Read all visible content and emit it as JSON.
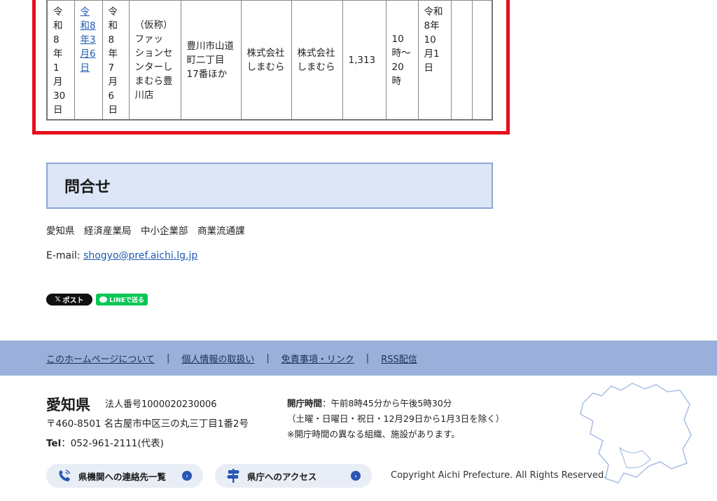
{
  "table": {
    "cells": [
      "令\n和\n8\n年1\n月\n30\n日",
      "令\n和8\n年3\n月6\n日",
      "令\n和8\n年7\n月6\n日",
      "（仮称）\nファッ\nションセ\nンターし\nまむら豊\n川店",
      "豊川市山道\n町二丁目\n17番ほか",
      "株式会社\nしまむら",
      "株式会社\nしまむら",
      "1,313",
      "10\n時～\n20\n時",
      "令和\n8年\n10\n月1\n日",
      "",
      ""
    ]
  },
  "contact": {
    "heading": "問合せ",
    "department": "愛知県　経済産業局　中小企業部　商業流通課",
    "email_label": "E-mail: ",
    "email": "shogyo@pref.aichi.lg.jp"
  },
  "share": {
    "x_label": "ポスト",
    "x_icon": "𝕏",
    "line_label": "LINEで送る"
  },
  "footer": {
    "links": [
      "このホームページについて",
      "個人情報の取扱い",
      "免責事項・リンク",
      "RSS配信"
    ],
    "pref_name": "愛知県",
    "corp_no": "法人番号1000020230006",
    "address": "〒460-8501 名古屋市中区三の丸三丁目1番2号",
    "tel_label": "Tel",
    "tel": "：052-961-2111(代表)",
    "hours_label": "開庁時間",
    "hours": "：午前8時45分から午後5時30分",
    "hours_note1": "（土曜・日曜日・祝日・12月29日から1月3日を除く）",
    "hours_note2": "※開庁時間の異なる組織、施設があります。",
    "contacts_button": "県機関への連絡先一覧",
    "access_button": "県庁へのアクセス",
    "copyright": "Copyright Aichi Prefecture. All Rights Reserved."
  },
  "colors": {
    "highlight": "#e60d1c",
    "link": "#1f5bb0",
    "footer_band": "#9ab0da",
    "contact_bg": "#dce6f6"
  }
}
